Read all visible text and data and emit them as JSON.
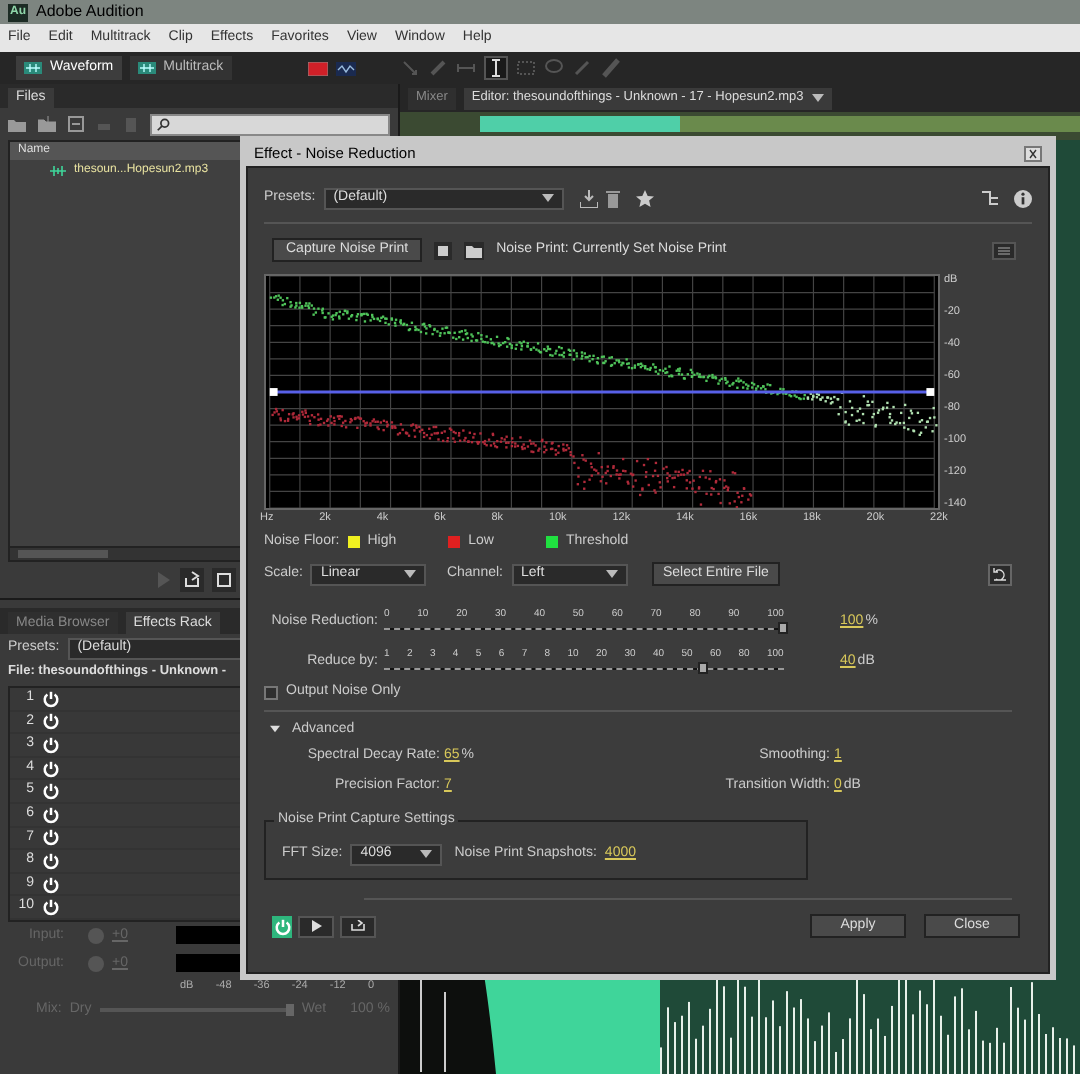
{
  "window": {
    "app_icon": "Au",
    "title": "Adobe Audition"
  },
  "menu": [
    "File",
    "Edit",
    "Multitrack",
    "Clip",
    "Effects",
    "Favorites",
    "View",
    "Window",
    "Help"
  ],
  "toolbar": {
    "views": [
      {
        "label": "Waveform",
        "selected": true
      },
      {
        "label": "Multitrack",
        "selected": false
      }
    ]
  },
  "files_panel": {
    "tab": "Files",
    "column": "Name",
    "files": [
      {
        "name": "thesoun...Hopesun2.mp3"
      }
    ]
  },
  "effects_rack": {
    "tabs": [
      {
        "label": "Media Browser",
        "selected": false
      },
      {
        "label": "Effects Rack",
        "selected": true
      }
    ],
    "presets_label": "Presets:",
    "preset": "(Default)",
    "file": "File: thesoundofthings - Unknown -",
    "slots": [
      "1",
      "2",
      "3",
      "4",
      "5",
      "6",
      "7",
      "8",
      "9",
      "10"
    ],
    "input_label": "Input:",
    "input_value": "+0",
    "output_label": "Output:",
    "output_value": "+0",
    "meter_scale": [
      "dB",
      "-48",
      "-36",
      "-24",
      "-12",
      "0"
    ],
    "mix_label": "Mix:",
    "dry": "Dry",
    "wet": "Wet",
    "mix_slider": {
      "level": 1.0
    },
    "mix_value": "100 %"
  },
  "editor_tabs": [
    {
      "label": "Mixer",
      "selected": false
    },
    {
      "label": "Editor: thesoundofthings - Unknown - 17 - Hopesun2.mp3",
      "selected": true
    }
  ],
  "dialog": {
    "title": "Effect - Noise Reduction",
    "presets_label": "Presets:",
    "preset": "(Default)",
    "capture_button": "Capture Noise Print",
    "noise_print_status": "Noise Print: Currently Set Noise Print",
    "graph": {
      "x_ticks": [
        "Hz",
        "2k",
        "4k",
        "6k",
        "8k",
        "10k",
        "12k",
        "14k",
        "16k",
        "18k",
        "20k",
        "22k"
      ],
      "y_ticks": [
        "dB",
        "-20",
        "-40",
        "-60",
        "-80",
        "-100",
        "-120",
        "-140"
      ]
    },
    "legend": {
      "label": "Noise Floor:",
      "items": [
        {
          "label": "High",
          "color": "#f0f020"
        },
        {
          "label": "Low",
          "color": "#e02020"
        },
        {
          "label": "Threshold",
          "color": "#20e040"
        }
      ]
    },
    "scale": {
      "label": "Scale:",
      "value": "Linear"
    },
    "channel": {
      "label": "Channel:",
      "value": "Left"
    },
    "select_button": "Select Entire File",
    "sliders": [
      {
        "label": "Noise Reduction:",
        "ticks": [
          "0",
          "10",
          "20",
          "30",
          "40",
          "50",
          "60",
          "70",
          "80",
          "90",
          "100"
        ],
        "level": 1.0,
        "value": "100",
        "unit": "%"
      },
      {
        "label": "Reduce by:",
        "ticks": [
          "1",
          "2",
          "3",
          "4",
          "5",
          "6",
          "7",
          "8",
          "10",
          "20",
          "30",
          "40",
          "50",
          "60",
          "80",
          "100"
        ],
        "level": 0.8,
        "value": "40",
        "unit": "dB"
      }
    ],
    "output_noise_only": {
      "label": "Output Noise Only",
      "checked": false
    },
    "advanced": {
      "label": "Advanced",
      "expanded": true,
      "params": [
        {
          "label": "Spectral Decay Rate:",
          "value": "65",
          "unit": "%"
        },
        {
          "label": "Smoothing:",
          "value": "1"
        },
        {
          "label": "Precision Factor:",
          "value": "7"
        },
        {
          "label": "Transition Width:",
          "value": "0",
          "unit": "dB"
        }
      ]
    },
    "capture_settings": {
      "title": "Noise Print Capture Settings",
      "fft_label": "FFT Size:",
      "fft_value": "4096",
      "snapshots_label": "Noise Print Snapshots:",
      "snapshots_value": "4000"
    },
    "power_on": true,
    "buttons": [
      "Apply",
      "Close"
    ]
  }
}
